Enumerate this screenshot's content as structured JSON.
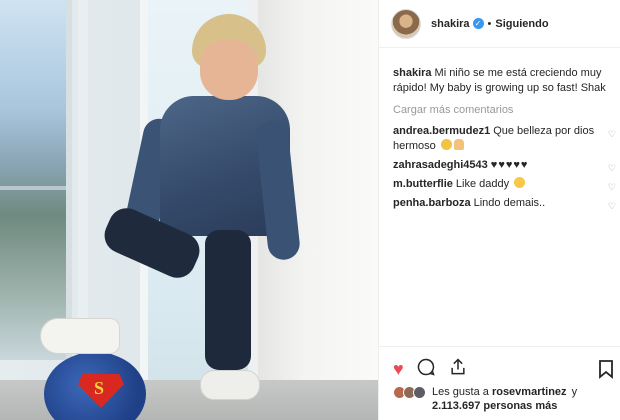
{
  "post": {
    "username": "shakira",
    "follow_status": "Siguiendo",
    "separator": "•",
    "caption_text": "Mi niño se me está creciendo muy rápido! My baby is growing up so fast! Shak",
    "load_more": "Cargar más comentarios",
    "comments": [
      {
        "user": "andrea.bermudez1",
        "text": "Que belleza por dios hermoso",
        "emojis": [
          "blush-emoji",
          "pray-emoji"
        ]
      },
      {
        "user": "zahrasadeghi4543",
        "text": "♥♥♥♥♥",
        "emojis": []
      },
      {
        "user": "m.butterflie",
        "text": "Like daddy",
        "emojis": [
          "star-eyes-emoji"
        ]
      },
      {
        "user": "penha.barboza",
        "text": "Lindo demais..",
        "emojis": []
      }
    ],
    "likes_prefix": "Les gusta a",
    "likes_user": "rosevmartinez",
    "likes_connector": "y",
    "likes_count": "2.113.697 personas más"
  },
  "icons": {
    "like": "heart-icon",
    "comment": "comment-icon",
    "share": "share-icon",
    "save": "bookmark-icon",
    "verified": "verified-badge-icon"
  },
  "colors": {
    "like": "#ed4956",
    "verified": "#3897f0",
    "muted": "#999999"
  }
}
